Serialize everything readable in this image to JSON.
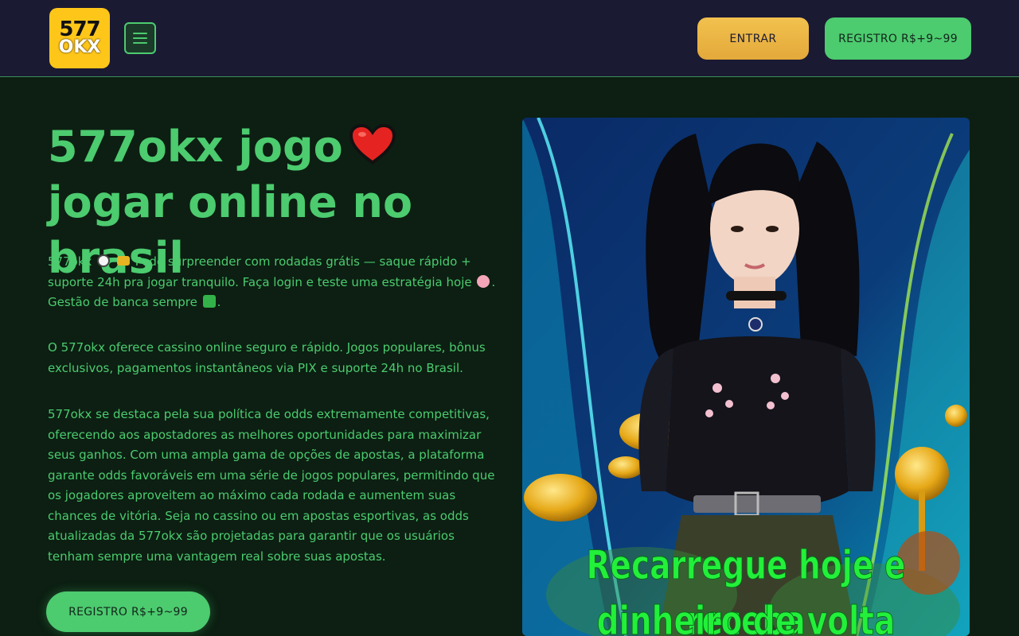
{
  "header": {
    "logo_line1": "577",
    "logo_line2": "OKX",
    "entrar_label": "ENTRAR",
    "registro_label": "REGISTRO R$+9~99"
  },
  "hero": {
    "title_part1": "577okx jogo",
    "title_part2": "jogar online no brasil",
    "p1": {
      "a": "577okx",
      "b": "Pode surpreender com rodadas grátis — saque rápido + suporte 24h pra jogar tranquilo. Faça login e teste uma estratégia hoje",
      "c": ". Gestão de banca sempre",
      "d": "."
    },
    "p2": "O 577okx oferece cassino online seguro e rápido. Jogos populares, bônus exclusivos, pagamentos instantâneos via PIX e suporte 24h no Brasil.",
    "p3": "577okx se destaca pela sua política de odds extremamente competitivas, oferecendo aos apostadores as melhores oportunidades para maximizar seus ganhos. Com uma ampla gama de opções de apostas, a plataforma garante odds favoráveis em uma série de jogos populares, permitindo que os jogadores aproveitem ao máximo cada rodada e aumentem suas chances de vitória. Seja no cassino ou em apostas esportivas, as odds atualizadas da 577okx são projetadas para garantir que os usuários tenham sempre uma vantagem real sobre suas apostas.",
    "cta_label": "REGISTRO R$+9~99"
  },
  "banner": {
    "line1": "Recarregue hoje e receba",
    "line2": "dinheiro de volta"
  },
  "icons": {
    "heart": "heart-icon",
    "clock": "clock-icon",
    "card": "credit-card-icon",
    "brain": "brain-icon",
    "check": "check-mark-icon",
    "menu": "hamburger-menu-icon"
  },
  "colors": {
    "accent_green": "#4ccb6f",
    "gold": "#f2c14e",
    "header_bg": "#1b1a33",
    "page_bg": "#0c1f12"
  }
}
